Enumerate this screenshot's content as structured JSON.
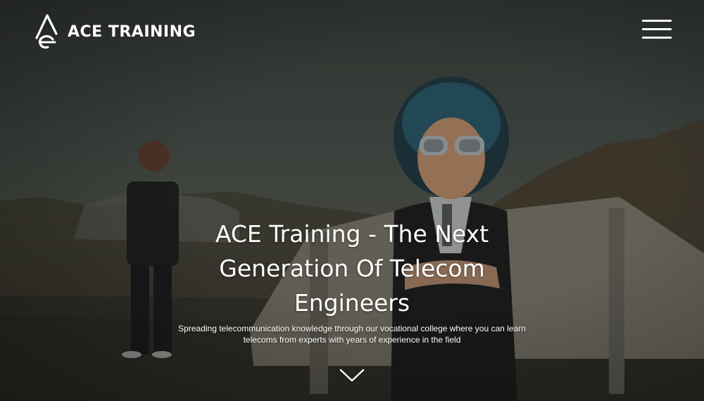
{
  "header": {
    "logo_text": "ACE TRAINING",
    "logo_icon": "ace-logo-icon",
    "menu_icon": "hamburger-menu-icon"
  },
  "hero": {
    "title": "ACE Training - The Next Generation Of Telecom Engineers",
    "subtitle": "Spreading telecommunication knowledge through our vocational college where you can learn telecoms from experts with years of experience in the field",
    "scroll_icon": "chevron-down-icon"
  },
  "colors": {
    "text": "#ffffff",
    "overlay": "#141412"
  }
}
